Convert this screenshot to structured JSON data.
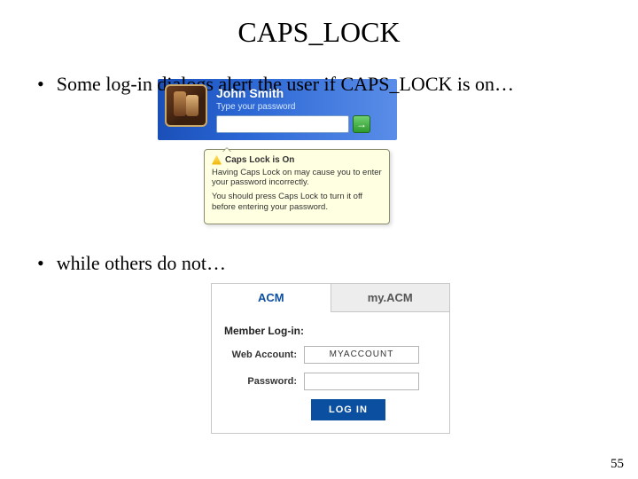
{
  "title": "CAPS_LOCK",
  "bullets": {
    "b1": "Some log-in dialogs alert the user if CAPS_LOCK is on…",
    "b2": "while others do not…"
  },
  "xp": {
    "username": "John Smith",
    "hint": "Type your password",
    "arrow": "→",
    "balloon_title": "Caps Lock is On",
    "balloon_p1": "Having Caps Lock on may cause you to enter your password incorrectly.",
    "balloon_p2": "You should press Caps Lock to turn it off before entering your password."
  },
  "acm": {
    "tab1": "ACM",
    "tab2": "my.ACM",
    "heading": "Member Log-in:",
    "label_account": "Web Account:",
    "label_password": "Password:",
    "account_value": "MYACCOUNT",
    "button": "LOG IN"
  },
  "page_number": "55"
}
